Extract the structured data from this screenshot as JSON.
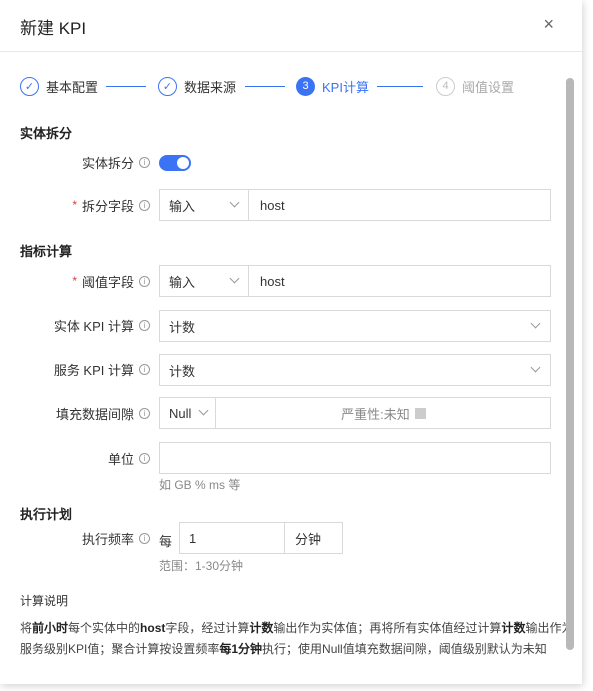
{
  "dialog": {
    "title": "新建 KPI",
    "close_glyph": "×"
  },
  "steps": [
    {
      "label": "基本配置",
      "state": "done",
      "glyph": "✓"
    },
    {
      "label": "数据来源",
      "state": "done",
      "glyph": "✓"
    },
    {
      "label": "KPI计算",
      "state": "active",
      "glyph": "3"
    },
    {
      "label": "阈值设置",
      "state": "pending",
      "glyph": "4"
    }
  ],
  "sections": {
    "entity_split": "实体拆分",
    "metric_calc": "指标计算",
    "schedule": "执行计划"
  },
  "fields": {
    "entity_split_toggle": {
      "label": "实体拆分",
      "on": true
    },
    "split_field": {
      "label": "拆分字段",
      "mode": "输入",
      "value": "host"
    },
    "threshold_field": {
      "label": "阈值字段",
      "mode": "输入",
      "value": "host"
    },
    "entity_kpi_calc": {
      "label": "实体 KPI 计算",
      "value": "计数"
    },
    "service_kpi_calc": {
      "label": "服务 KPI 计算",
      "value": "计数"
    },
    "fill_gap": {
      "label": "填充数据间隙",
      "mode": "Null",
      "severity_label": "严重性:",
      "severity_value": "未知"
    },
    "unit": {
      "label": "单位",
      "value": "",
      "hint": "如 GB % ms 等"
    },
    "frequency": {
      "label": "执行频率",
      "prefix": "每",
      "value": "1",
      "unit": "分钟",
      "hint": "范围：1-30分钟"
    }
  },
  "description": {
    "title": "计算说明",
    "line1": [
      {
        "t": "将",
        "b": false
      },
      {
        "t": "前小时",
        "b": true
      },
      {
        "t": "每个实体中的",
        "b": false
      },
      {
        "t": "host",
        "b": true
      },
      {
        "t": "字段，经过计算",
        "b": false
      },
      {
        "t": "计数",
        "b": true
      },
      {
        "t": "输出作为实体值；再将所有实体值经过计算",
        "b": false
      },
      {
        "t": "计数",
        "b": true
      },
      {
        "t": "输出作为",
        "b": false
      }
    ],
    "line2": [
      {
        "t": "服务级别KPI值；聚合计算按设置频率",
        "b": false
      },
      {
        "t": "每1分钟",
        "b": true
      },
      {
        "t": "执行；使用Null值填充数据间隙，阈值级别默认为未知",
        "b": false
      }
    ]
  }
}
